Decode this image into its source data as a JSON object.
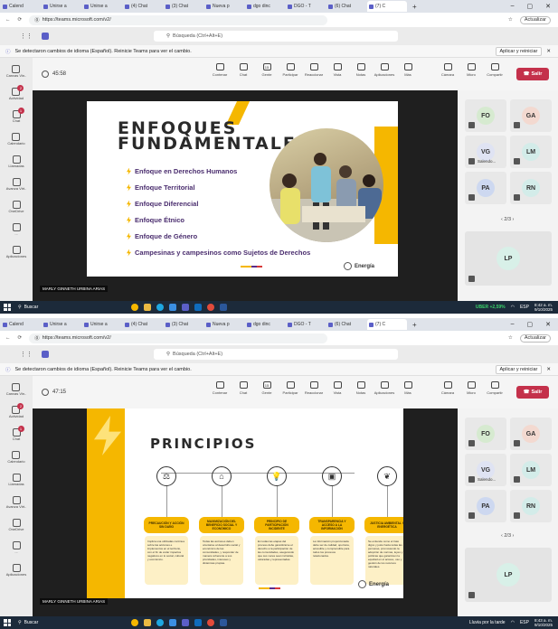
{
  "browser": {
    "tabs_top": [
      "Calend",
      "Unirse a",
      "Unirse a",
      "(4) Chat",
      "(3) Chat",
      "Nueva p",
      "dgo dinc",
      "DGO - T",
      "(6) Chat",
      "(7) C"
    ],
    "tabs_bottom": [
      "Calend",
      "Unirse a",
      "Unirse a",
      "(4) Chat",
      "(3) Chat",
      "Nueva p",
      "dgo dinc",
      "DGO - T",
      "(6) Chat",
      "(7) C"
    ],
    "url": "https://teams.microsoft.com/v2/",
    "update_label": "Actualizar",
    "new_tab": "+"
  },
  "teams": {
    "search_placeholder": "Búsqueda (Ctrl+Alt+E)",
    "notice": "Se detectaron cambios de idioma (Español). Reinicie Teams para ver el cambio.",
    "notice_button": "Aplicar y reiniciar",
    "rail": [
      {
        "label": "Canvas Vin..",
        "icon": "back-icon"
      },
      {
        "label": "Actividad",
        "icon": "bell-icon",
        "badge": "2"
      },
      {
        "label": "Chat",
        "icon": "chat-icon",
        "badge": "1"
      },
      {
        "label": "Calendario",
        "icon": "calendar-icon"
      },
      {
        "label": "Llamadas",
        "icon": "phone-icon"
      },
      {
        "label": "Avanza Virt..",
        "icon": "app-icon"
      },
      {
        "label": "OneDrive",
        "icon": "cloud-icon"
      },
      {
        "label": "...",
        "icon": "more-icon"
      },
      {
        "label": "Aplicaciones",
        "icon": "apps-icon"
      }
    ],
    "controls": [
      "Contenar",
      "Chat",
      "Gente",
      "Participar",
      "Reaccionar",
      "Vista",
      "Notas",
      "Aplicaciones",
      "Más"
    ],
    "people_count": "15",
    "controls_right": [
      "Cámara",
      "Micro",
      "Compartir"
    ],
    "leave_label": "Salir"
  },
  "meeting_top": {
    "timer": "45:58",
    "presenter": "MARLY GINNETH URBINA ARIAS",
    "participants": [
      {
        "initials": "FO",
        "color": "#d6ead0"
      },
      {
        "initials": "GA",
        "color": "#f3d9d0"
      },
      {
        "initials": "VG",
        "color": "#dfe3f3",
        "name": "Salendo..."
      },
      {
        "initials": "LM",
        "color": "#d3ece9"
      },
      {
        "initials": "PA",
        "color": "#cdd8f0"
      },
      {
        "initials": "RN",
        "color": "#d3ece9"
      }
    ],
    "pager": "‹ 2/3 ›",
    "big_tile": "LP",
    "slide": {
      "title_line1": "ENFOQUES",
      "title_line2": "FUNDAMENTALES",
      "items": [
        "Enfoque en Derechos Humanos",
        "Enfoque Territorial",
        "Enfoque Diferencial",
        "Enfoque Étnico",
        "Enfoque de Género",
        "Campesinas y campesinos como Sujetos de Derechos"
      ],
      "logo": "Energía"
    }
  },
  "meeting_bottom": {
    "timer": "47:15",
    "presenter": "MARLY GINNETH URBINA ARIAS",
    "participants": [
      {
        "initials": "FO",
        "color": "#d6ead0"
      },
      {
        "initials": "GA",
        "color": "#f3d9d0"
      },
      {
        "initials": "VG",
        "color": "#dfe3f3",
        "name": "Salendo..."
      },
      {
        "initials": "LM",
        "color": "#d3ece9"
      },
      {
        "initials": "PA",
        "color": "#cdd8f0"
      },
      {
        "initials": "RN",
        "color": "#d3ece9"
      }
    ],
    "pager": "‹ 2/3 ›",
    "big_tile": "LP",
    "slide": {
      "title": "PRINCIPIOS",
      "columns": [
        {
          "head": "PRECAUCIÓN Y ACCIÓN SIN DAÑO",
          "body": "Implica una utilizadas continua sobre las acciones e implementos en el territorio, con el fin de evitar impactos negativos en lo social, cultural y económico."
        },
        {
          "head": "MAXIMIZACIÓN DEL BENEFICIO SOCIAL Y ECONÓMICO",
          "body": "Todas las acciones deben orientarse al desarrollo social y económico de las comunidades, y responder de manera coherente a sus prioridades, intereses y dinámicas propias."
        },
        {
          "head": "PRINCIPIO DE PARTICIPACIÓN INCIDENTE",
          "body": "En todas las etapas del proceso debe garantizarse el derecho a la participación de las comunidades, asegurando que sus voces sean incluidas, valoradas y representadas."
        },
        {
          "head": "TRANSPARENCIA Y ACCESO A LA INFORMACIÓN",
          "body": "La información proporcionada debe ser de calidad, oportuna, accesible y comprensible para todos los procesos relacionados."
        },
        {
          "head": "JUSTICIA AMBIENTAL Y ENERGÉTICA",
          "body": "Se entiende como el trato digno y justo hacia todas las personas, promoviendo la adopción de normas, leyes y políticas que garanticen la equidad en el acceso, uso y gestión de los recursos naturales."
        }
      ],
      "logo": "Energía"
    }
  },
  "taskbar_top": {
    "search": "Buscar",
    "weather": "UBER +2,59%",
    "lang": "ESP",
    "time": "8:42 a. m.",
    "date": "9/10/2025"
  },
  "taskbar_bottom": {
    "search": "Buscar",
    "weather": "Lluvia por la tarde",
    "lang": "ESP",
    "time": "8:43 a. m.",
    "date": "9/10/2025"
  }
}
